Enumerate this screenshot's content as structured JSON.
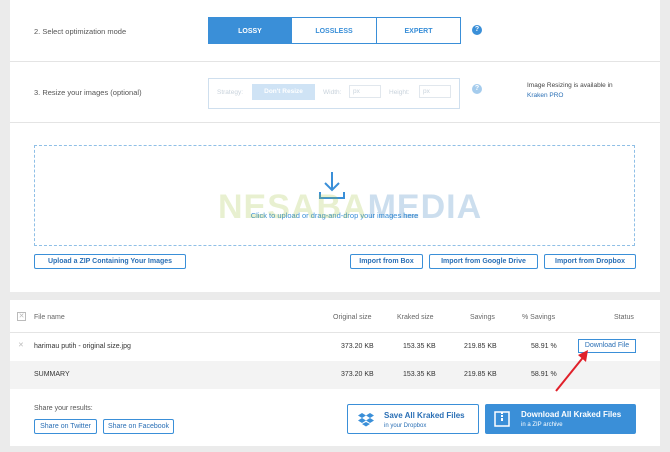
{
  "steps": {
    "mode_label": "2. Select optimization mode",
    "modes": [
      {
        "label": "LOSSY",
        "active": true
      },
      {
        "label": "LOSSLESS",
        "active": false
      },
      {
        "label": "EXPERT",
        "active": false
      }
    ],
    "resize_label": "3. Resize your images",
    "resize_optional": "(optional)",
    "strategy_label": "Strategy:",
    "strategy_value": "Don't Resize",
    "width_label": "Width:",
    "width_placeholder": "px",
    "height_label": "Height:",
    "height_placeholder": "px",
    "resize_note": "Image Resizing is available in",
    "resize_note_link": "Kraken PRO",
    "help_glyph": "?"
  },
  "upload": {
    "drop_text": "Click to upload or drag-and-drop your images here",
    "zip_button": "Upload a ZIP Containing Your Images",
    "import_box": "Import from Box",
    "import_drive": "Import from Google Drive",
    "import_dropbox": "Import from Dropbox"
  },
  "watermark": {
    "part1": "NESABA",
    "part2": "MEDIA"
  },
  "results": {
    "columns": [
      "File name",
      "Original size",
      "Kraked size",
      "Savings",
      "% Savings",
      "Status"
    ],
    "rows": [
      {
        "file": "harimau putih - original size.jpg",
        "original": "373.20 KB",
        "kraked": "153.35 KB",
        "savings": "219.85 KB",
        "pct": "58.91 %",
        "status": "Download File"
      }
    ],
    "summary": {
      "file": "SUMMARY",
      "original": "373.20 KB",
      "kraked": "153.35 KB",
      "savings": "219.85 KB",
      "pct": "58.91 %"
    },
    "share_label": "Share your results:",
    "share_twitter": "Share on Twitter",
    "share_facebook": "Share on Facebook",
    "save_dropbox": "Save All Kraked Files",
    "save_dropbox_sub": "in your Dropbox",
    "download_zip": "Download All Kraked Files",
    "download_zip_sub": "in a ZIP archive"
  },
  "colors": {
    "accent": "#3a8fd8",
    "arrow": "#e0202a"
  }
}
